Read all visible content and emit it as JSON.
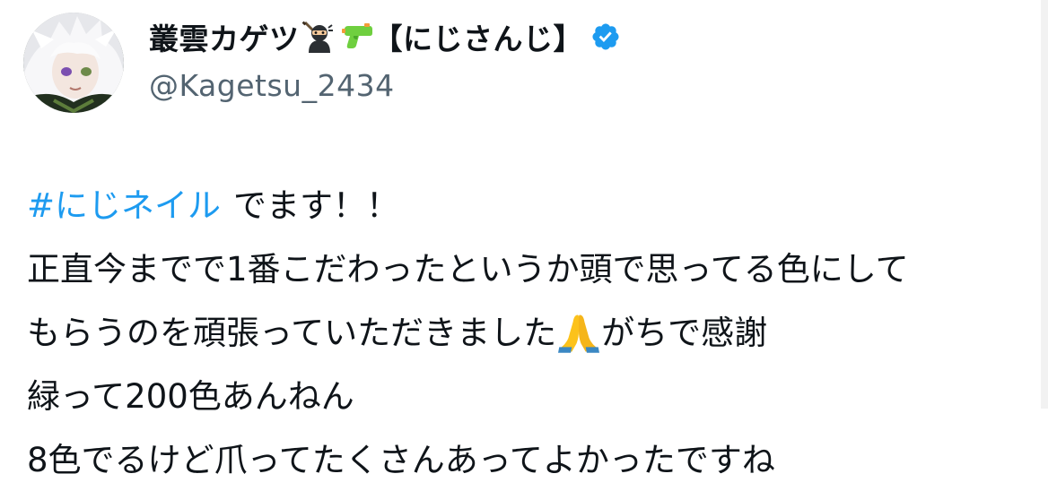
{
  "author": {
    "display_name": "叢雲カゲツ",
    "name_suffix": "【にじさんじ】",
    "handle": "@Kagetsu_2434",
    "name_emojis": [
      "ninja-icon",
      "water-pistol-icon"
    ],
    "verified": true,
    "verified_color": "#1d9bf0"
  },
  "tweet": {
    "hashtag": "#にじネイル",
    "line1_rest": "でます！！",
    "line2": "正直今までで1番こだわったというか頭で思ってる色にして",
    "line3_before_emoji": "もらうのを頑張っていただきました",
    "line3_emoji": "folded-hands-icon",
    "line3_after_emoji": "がちで感謝",
    "line4": "緑って200色あんねん",
    "line5": "8色でるけど爪ってたくさんあってよかったですね"
  },
  "colors": {
    "text": "#0f1419",
    "secondary_text": "#536471",
    "link": "#1d9bf0"
  }
}
